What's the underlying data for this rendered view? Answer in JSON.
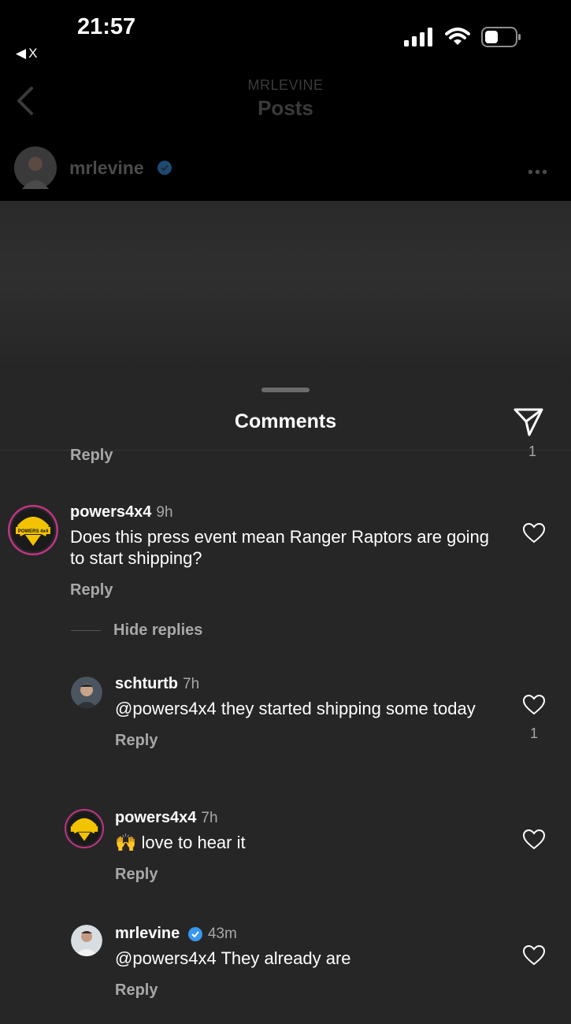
{
  "status_bar": {
    "time": "21:57",
    "back_app_label": "X"
  },
  "nav": {
    "subtitle": "MRLEVINE",
    "title": "Posts",
    "post_username": "mrlevine"
  },
  "sheet": {
    "title": "Comments",
    "clipped_reply_label": "Reply",
    "clipped_like_count": "1"
  },
  "comments": [
    {
      "username": "powers4x4",
      "time": "9h",
      "text": "Does this press event mean Ranger Raptors are going to start shipping?",
      "reply_label": "Reply"
    },
    {
      "username": "schturtb",
      "time": "7h",
      "text": "@powers4x4 they started shipping some today",
      "reply_label": "Reply",
      "likes": "1"
    },
    {
      "username": "powers4x4",
      "time": "7h",
      "emoji": "🙌",
      "text": "love to hear it",
      "reply_label": "Reply"
    },
    {
      "username": "mrlevine",
      "time": "43m",
      "text": "@powers4x4 They already are",
      "reply_label": "Reply"
    }
  ],
  "hide_replies_label": "Hide replies",
  "avatar_badge_text": "POWERS 4x4",
  "colors": {
    "sheet_bg": "#262626",
    "verified_blue": "#3897f0",
    "secondary_text": "#a8a8a8",
    "powers_ring": "#c13584",
    "powers_yellow": "#f2c300"
  }
}
